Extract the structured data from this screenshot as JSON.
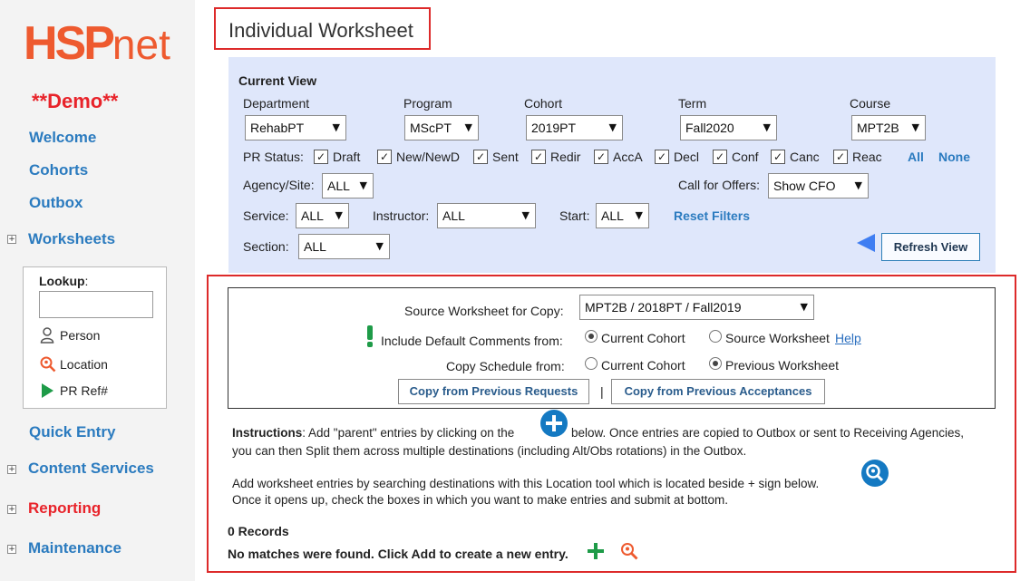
{
  "sidebar": {
    "logo": {
      "main": "HSP",
      "suffix": "net"
    },
    "demo_label": "**Demo**",
    "links": {
      "welcome": "Welcome",
      "cohorts": "Cohorts",
      "outbox": "Outbox",
      "worksheets": "Worksheets",
      "quick_entry": "Quick Entry",
      "content_services": "Content Services",
      "reporting": "Reporting",
      "maintenance": "Maintenance"
    },
    "expand_symbol": "+",
    "lookup": {
      "label": "Lookup",
      "colon": ":",
      "input_value": "",
      "items": {
        "person": "Person",
        "location": "Location",
        "pr_ref": "PR Ref#"
      }
    }
  },
  "page_title": "Individual Worksheet",
  "current_view": {
    "heading": "Current View",
    "department": {
      "label": "Department",
      "value": "RehabPT"
    },
    "program": {
      "label": "Program",
      "value": "MScPT"
    },
    "cohort": {
      "label": "Cohort",
      "value": "2019PT"
    },
    "term": {
      "label": "Term",
      "value": "Fall2020"
    },
    "course": {
      "label": "Course",
      "value": "MPT2B"
    },
    "pr_status": {
      "label": "PR Status:",
      "options": [
        "Draft",
        "New/NewD",
        "Sent",
        "Redir",
        "AccA",
        "Decl",
        "Conf",
        "Canc",
        "Reac"
      ],
      "all_label": "All",
      "none_label": "None"
    },
    "agency_site": {
      "label": "Agency/Site:",
      "value": "ALL"
    },
    "call_for_offers": {
      "label": "Call for Offers:",
      "value": "Show CFO"
    },
    "service": {
      "label": "Service:",
      "value": "ALL"
    },
    "instructor": {
      "label": "Instructor:",
      "value": "ALL"
    },
    "start": {
      "label": "Start:",
      "value": "ALL"
    },
    "reset_filters": "Reset Filters",
    "section": {
      "label": "Section:",
      "value": "ALL"
    },
    "refresh_button": "Refresh View"
  },
  "copy": {
    "source_label": "Source Worksheet for Copy:",
    "source_value": "MPT2B / 2018PT / Fall2019",
    "include_comments_label": "Include Default Comments from:",
    "comments_options": [
      "Current Cohort",
      "Source Worksheet"
    ],
    "help_link": "Help",
    "schedule_label": "Copy Schedule from:",
    "schedule_options": [
      "Current Cohort",
      "Previous Worksheet"
    ],
    "btn_requests": "Copy from Previous Requests",
    "separator": "|",
    "btn_acceptances": "Copy from Previous Acceptances"
  },
  "instructions": {
    "heading": "Instructions",
    "line1_a": ":  Add \"parent\" entries by clicking on the",
    "line1_b": "below. Once entries are copied to Outbox or sent to Receiving Agencies,",
    "line2": "you can then Split them across multiple destinations (including Alt/Obs rotations) in the Outbox.",
    "line3": "Add worksheet entries by searching destinations with this Location tool which is located beside + sign below.",
    "line4": "Once it opens up, check the boxes in which you want to make entries and submit at bottom."
  },
  "records_count": "0 Records",
  "no_matches": "No matches were found. Click Add to create a new entry.",
  "colors": {
    "accent_blue": "#2b7bbf",
    "alert_red": "#e8232a",
    "logo_orange": "#ee5a2f",
    "panel_bg": "#dfe7fb"
  }
}
